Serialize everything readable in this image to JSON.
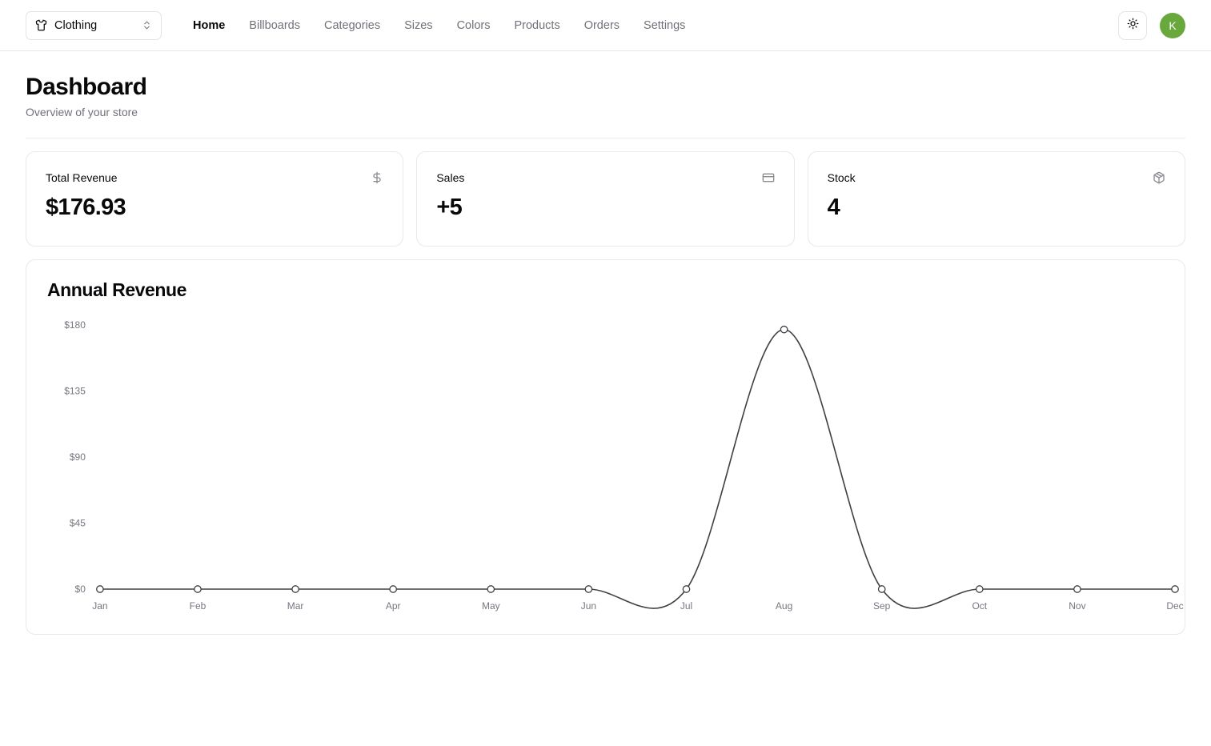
{
  "navbar": {
    "store_switcher": {
      "label": "Clothing",
      "icon": "shirt-icon",
      "chevron_icon": "chevrons-up-down-icon"
    },
    "nav_items": [
      {
        "label": "Home",
        "active": true
      },
      {
        "label": "Billboards",
        "active": false
      },
      {
        "label": "Categories",
        "active": false
      },
      {
        "label": "Sizes",
        "active": false
      },
      {
        "label": "Colors",
        "active": false
      },
      {
        "label": "Products",
        "active": false
      },
      {
        "label": "Orders",
        "active": false
      },
      {
        "label": "Settings",
        "active": false
      }
    ],
    "theme_toggle": {
      "icon": "sun-icon"
    },
    "avatar": {
      "initial": "K",
      "color": "#68a83d"
    }
  },
  "page": {
    "title": "Dashboard",
    "subtitle": "Overview of your store"
  },
  "stats": [
    {
      "title": "Total Revenue",
      "value": "$176.93",
      "icon": "dollar-sign-icon"
    },
    {
      "title": "Sales",
      "value": "+5",
      "icon": "credit-card-icon"
    },
    {
      "title": "Stock",
      "value": "4",
      "icon": "package-icon"
    }
  ],
  "chart_card": {
    "title": "Annual Revenue"
  },
  "chart_data": {
    "type": "line",
    "title": "Annual Revenue",
    "xlabel": "",
    "ylabel": "",
    "categories": [
      "Jan",
      "Feb",
      "Mar",
      "Apr",
      "May",
      "Jun",
      "Jul",
      "Aug",
      "Sep",
      "Oct",
      "Nov",
      "Dec"
    ],
    "values": [
      0,
      0,
      0,
      0,
      0,
      0,
      0,
      176.93,
      0,
      0,
      0,
      0
    ],
    "series": [
      {
        "name": "Revenue",
        "values": [
          0,
          0,
          0,
          0,
          0,
          0,
          0,
          176.93,
          0,
          0,
          0,
          0
        ]
      }
    ],
    "y_ticks": [
      "$0",
      "$45",
      "$90",
      "$135",
      "$180"
    ],
    "y_tick_values": [
      0,
      45,
      90,
      135,
      180
    ],
    "ylim": [
      0,
      180
    ],
    "grid": false,
    "legend": "none",
    "line_color": "#3f3f46",
    "marker": "open-circle",
    "marker_fill": "#ffffff",
    "curve": "smooth"
  }
}
